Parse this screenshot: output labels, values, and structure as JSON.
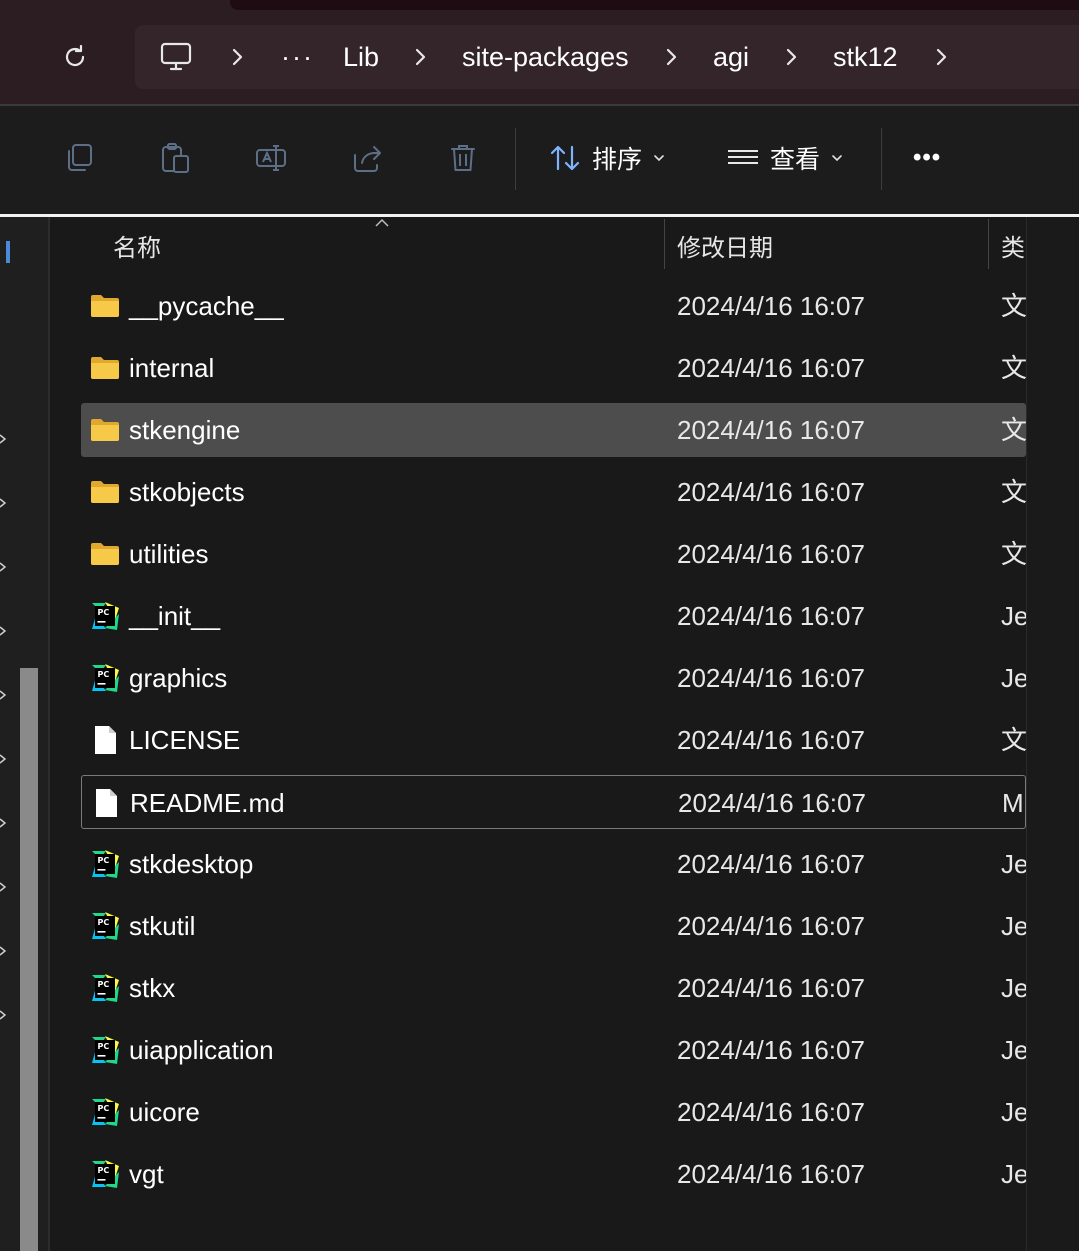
{
  "address": {
    "refresh_icon": "refresh-icon",
    "pc_icon": "computer-icon",
    "overflow": "···",
    "crumbs": [
      "Lib",
      "site-packages",
      "agi",
      "stk12"
    ]
  },
  "toolbar": {
    "copy_icon": "copy-icon",
    "paste_icon": "paste-icon",
    "rename_icon": "rename-icon",
    "share_icon": "share-icon",
    "delete_icon": "trash-icon",
    "sort_label": "排序",
    "view_label": "查看",
    "more_label": "•••"
  },
  "columns": {
    "name": "名称",
    "modified": "修改日期",
    "type": "类"
  },
  "files": [
    {
      "name": "__pycache__",
      "date": "2024/4/16 16:07",
      "type": "文",
      "icon": "folder-icon"
    },
    {
      "name": "internal",
      "date": "2024/4/16 16:07",
      "type": "文",
      "icon": "folder-icon"
    },
    {
      "name": "stkengine",
      "date": "2024/4/16 16:07",
      "type": "文",
      "icon": "folder-icon",
      "selected": true
    },
    {
      "name": "stkobjects",
      "date": "2024/4/16 16:07",
      "type": "文",
      "icon": "folder-icon"
    },
    {
      "name": "utilities",
      "date": "2024/4/16 16:07",
      "type": "文",
      "icon": "folder-icon"
    },
    {
      "name": "__init__",
      "date": "2024/4/16 16:07",
      "type": "Je",
      "icon": "pycharm-icon"
    },
    {
      "name": "graphics",
      "date": "2024/4/16 16:07",
      "type": "Je",
      "icon": "pycharm-icon"
    },
    {
      "name": "LICENSE",
      "date": "2024/4/16 16:07",
      "type": "文",
      "icon": "document-icon"
    },
    {
      "name": "README.md",
      "date": "2024/4/16 16:07",
      "type": "M",
      "icon": "document-icon",
      "focused": true
    },
    {
      "name": "stkdesktop",
      "date": "2024/4/16 16:07",
      "type": "Je",
      "icon": "pycharm-icon"
    },
    {
      "name": "stkutil",
      "date": "2024/4/16 16:07",
      "type": "Je",
      "icon": "pycharm-icon"
    },
    {
      "name": "stkx",
      "date": "2024/4/16 16:07",
      "type": "Je",
      "icon": "pycharm-icon"
    },
    {
      "name": "uiapplication",
      "date": "2024/4/16 16:07",
      "type": "Je",
      "icon": "pycharm-icon"
    },
    {
      "name": "uicore",
      "date": "2024/4/16 16:07",
      "type": "Je",
      "icon": "pycharm-icon"
    },
    {
      "name": "vgt",
      "date": "2024/4/16 16:07",
      "type": "Je",
      "icon": "pycharm-icon"
    }
  ],
  "colors": {
    "folder": "#f7c948",
    "selected_row": "#4d4d4d",
    "background": "#191919",
    "titlebar": "#2b1d22"
  }
}
